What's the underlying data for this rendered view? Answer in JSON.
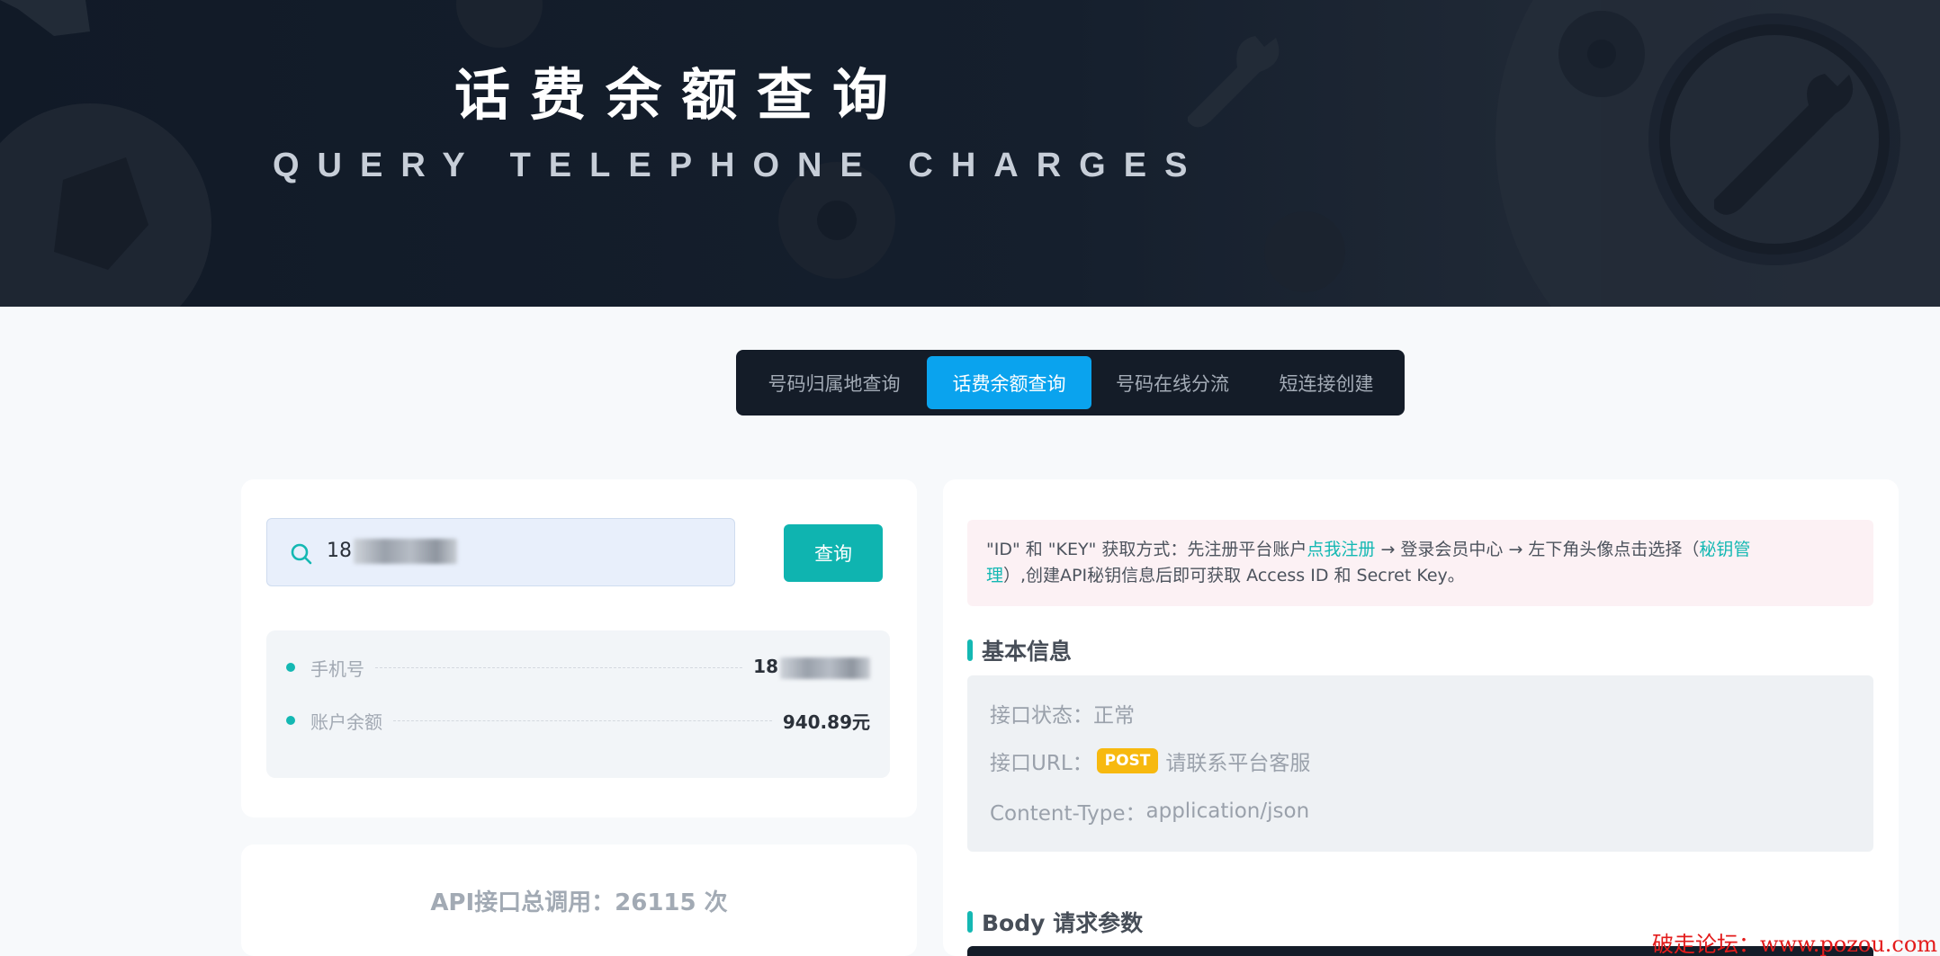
{
  "hero": {
    "title": "话费余额查询",
    "subtitle": "QUERY TELEPHONE CHARGES"
  },
  "tabs": [
    {
      "label": "号码归属地查询",
      "active": false
    },
    {
      "label": "话费余额查询",
      "active": true
    },
    {
      "label": "号码在线分流",
      "active": false
    },
    {
      "label": "短连接创建",
      "active": false
    }
  ],
  "query": {
    "input_value": "18",
    "button_label": "查询"
  },
  "result": {
    "phone_label": "手机号",
    "phone_value": "18",
    "balance_label": "账户余额",
    "balance_value": "940.89元"
  },
  "api": {
    "total_calls": "API接口总调用：26115 次"
  },
  "notice": {
    "text_1": "\"ID\" 和 \"KEY\" 获取方式：先注册平台账户",
    "link_register": "点我注册",
    "text_2": " → 登录会员中心 → 左下角头像点击选择（",
    "link_key_manage_1": "秘钥管",
    "link_key_manage_2": "理",
    "text_3": "）,创建API秘钥信息后即可获取 Access ID 和 Secret Key。"
  },
  "basic_info": {
    "title": "基本信息",
    "status_label": "接口状态：",
    "status_value": "正常",
    "url_label": "接口URL：",
    "method_badge": "POST",
    "url_value": "请联系平台客服",
    "content_type_label": "Content-Type：",
    "content_type_value": "application/json"
  },
  "body_params": {
    "title": "Body 请求参数"
  },
  "watermark": "破走论坛：www.pozou.com",
  "colors": {
    "accent_teal": "#14b8b3",
    "tab_active_blue": "#0aa3ee",
    "post_badge": "#f7b90f",
    "hero_bg": "#111a27",
    "watermark_red": "#e31b1b"
  }
}
